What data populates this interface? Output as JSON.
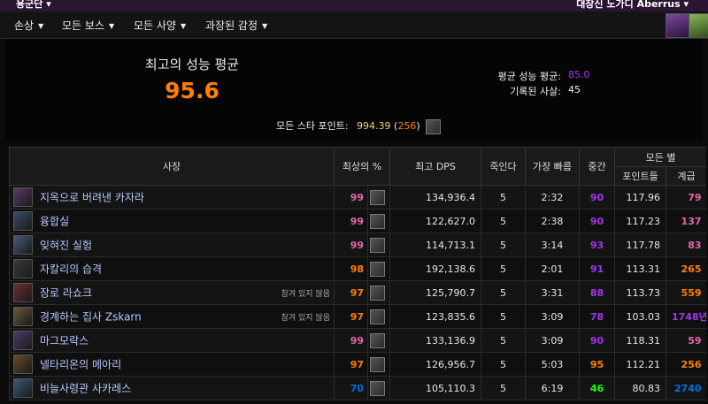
{
  "topbar": {
    "left": "용군단 ▾",
    "right": "대장신 노가디 Aberrus ▾"
  },
  "menu": [
    {
      "label": "손상"
    },
    {
      "label": "모든 보스"
    },
    {
      "label": "모든 사양"
    },
    {
      "label": "과장된 감정"
    }
  ],
  "summary": {
    "best_title": "최고의 성능 평균",
    "best_value": "95.6",
    "avg_label": "평균 성능 평균:",
    "avg_value": "85.0",
    "kills_label": "기록된 사살:",
    "kills_value": "45",
    "allstar_label": "모든 스타 포인트:",
    "allstar_points": "994.39",
    "allstar_rank_open": "(",
    "allstar_rank": "256",
    "allstar_rank_close": ")"
  },
  "table": {
    "headers": {
      "boss": "사장",
      "best_pct": "최상의 %",
      "best_dps": "최고 DPS",
      "kills": "죽인다",
      "fastest": "가장 빠름",
      "median": "중간",
      "allstars": "모든 별",
      "points": "포인트들",
      "rank": "계급"
    },
    "rows": [
      {
        "boss": "지옥으로 버려낸 카자라",
        "note": "",
        "pct": "99",
        "pct_color": "#e268a8",
        "dps": "134,936.4",
        "kills": "5",
        "fastest": "2:32",
        "median": "90",
        "median_color": "#a335ee",
        "points": "117.96",
        "rank": "79",
        "rank_color": "#e268a8"
      },
      {
        "boss": "융합실",
        "note": "",
        "pct": "99",
        "pct_color": "#e268a8",
        "dps": "122,627.0",
        "kills": "5",
        "fastest": "2:38",
        "median": "90",
        "median_color": "#a335ee",
        "points": "117.23",
        "rank": "137",
        "rank_color": "#e268a8"
      },
      {
        "boss": "잊혀진 실험",
        "note": "",
        "pct": "99",
        "pct_color": "#e268a8",
        "dps": "114,713.1",
        "kills": "5",
        "fastest": "3:14",
        "median": "93",
        "median_color": "#a335ee",
        "points": "117.78",
        "rank": "83",
        "rank_color": "#e268a8"
      },
      {
        "boss": "자칼리의 습격",
        "note": "",
        "pct": "98",
        "pct_color": "#ff8000",
        "dps": "192,138.6",
        "kills": "5",
        "fastest": "2:01",
        "median": "91",
        "median_color": "#a335ee",
        "points": "113.31",
        "rank": "265",
        "rank_color": "#ff8000"
      },
      {
        "boss": "장로 라쇼크",
        "note": "참겨 있지 않음",
        "pct": "97",
        "pct_color": "#ff8000",
        "dps": "125,790.7",
        "kills": "5",
        "fastest": "3:31",
        "median": "88",
        "median_color": "#a335ee",
        "points": "113.73",
        "rank": "559",
        "rank_color": "#ff8000"
      },
      {
        "boss": "경계하는 집사 Zskarn",
        "note": "참겨 있지 않음",
        "pct": "97",
        "pct_color": "#ff8000",
        "dps": "123,835.6",
        "kills": "5",
        "fastest": "3:09",
        "median": "78",
        "median_color": "#a335ee",
        "points": "103.03",
        "rank": "1748년",
        "rank_color": "#a335ee"
      },
      {
        "boss": "마그모락스",
        "note": "",
        "pct": "99",
        "pct_color": "#e268a8",
        "dps": "133,136.9",
        "kills": "5",
        "fastest": "3:09",
        "median": "90",
        "median_color": "#a335ee",
        "points": "118.31",
        "rank": "59",
        "rank_color": "#e268a8"
      },
      {
        "boss": "넬타리온의 메아리",
        "note": "",
        "pct": "97",
        "pct_color": "#ff8000",
        "dps": "126,956.7",
        "kills": "5",
        "fastest": "5:03",
        "median": "95",
        "median_color": "#ff8000",
        "points": "112.21",
        "rank": "256",
        "rank_color": "#ff8000"
      },
      {
        "boss": "비늘사령관 사카레스",
        "note": "",
        "pct": "70",
        "pct_color": "#0070dd",
        "dps": "105,110.3",
        "kills": "5",
        "fastest": "6:19",
        "median": "46",
        "median_color": "#1eff00",
        "points": "80.83",
        "rank": "2740",
        "rank_color": "#0070dd"
      }
    ]
  },
  "colors": {
    "legendary": "#ff8000",
    "epic": "#a335ee",
    "artifact": "#e268a8",
    "rare": "#0070dd",
    "uncommon": "#1eff00",
    "accent_bg": "#2a1533"
  },
  "icons": {
    "menu_caret": "caret-down-icon",
    "spec": "spec-portrait-icon",
    "boss": "boss-portrait-icon",
    "toolbar": [
      "raid-icon",
      "key-icon"
    ]
  }
}
